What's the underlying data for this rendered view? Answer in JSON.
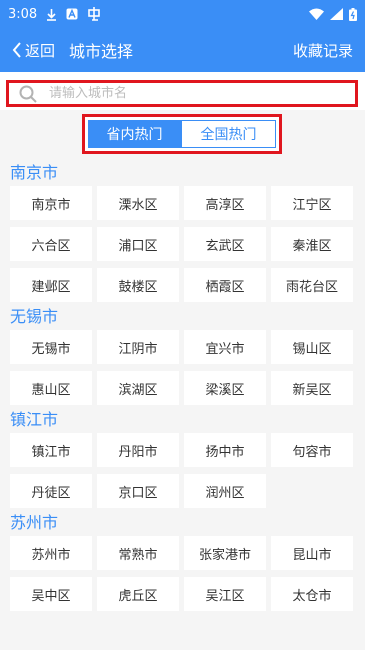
{
  "status_bar": {
    "time": "3:08"
  },
  "header": {
    "back_label": "返回",
    "title": "城市选择",
    "favorites_label": "收藏记录"
  },
  "search": {
    "placeholder": "请输入城市名",
    "value": ""
  },
  "tabs": [
    {
      "label": "省内热门",
      "active": true
    },
    {
      "label": "全国热门",
      "active": false
    }
  ],
  "sections": [
    {
      "title": "南京市",
      "cities": [
        "南京市",
        "溧水区",
        "高淳区",
        "江宁区",
        "六合区",
        "浦口区",
        "玄武区",
        "秦淮区",
        "建邺区",
        "鼓楼区",
        "栖霞区",
        "雨花台区"
      ]
    },
    {
      "title": "无锡市",
      "cities": [
        "无锡市",
        "江阴市",
        "宜兴市",
        "锡山区",
        "惠山区",
        "滨湖区",
        "梁溪区",
        "新吴区"
      ]
    },
    {
      "title": "镇江市",
      "cities": [
        "镇江市",
        "丹阳市",
        "扬中市",
        "句容市",
        "丹徒区",
        "京口区",
        "润州区"
      ]
    },
    {
      "title": "苏州市",
      "cities": [
        "苏州市",
        "常熟市",
        "张家港市",
        "昆山市",
        "吴中区",
        "虎丘区",
        "吴江区",
        "太仓市"
      ]
    }
  ],
  "colors": {
    "primary": "#3a8ef6",
    "highlight_border": "#e0161e",
    "background": "#f5f5f5"
  }
}
